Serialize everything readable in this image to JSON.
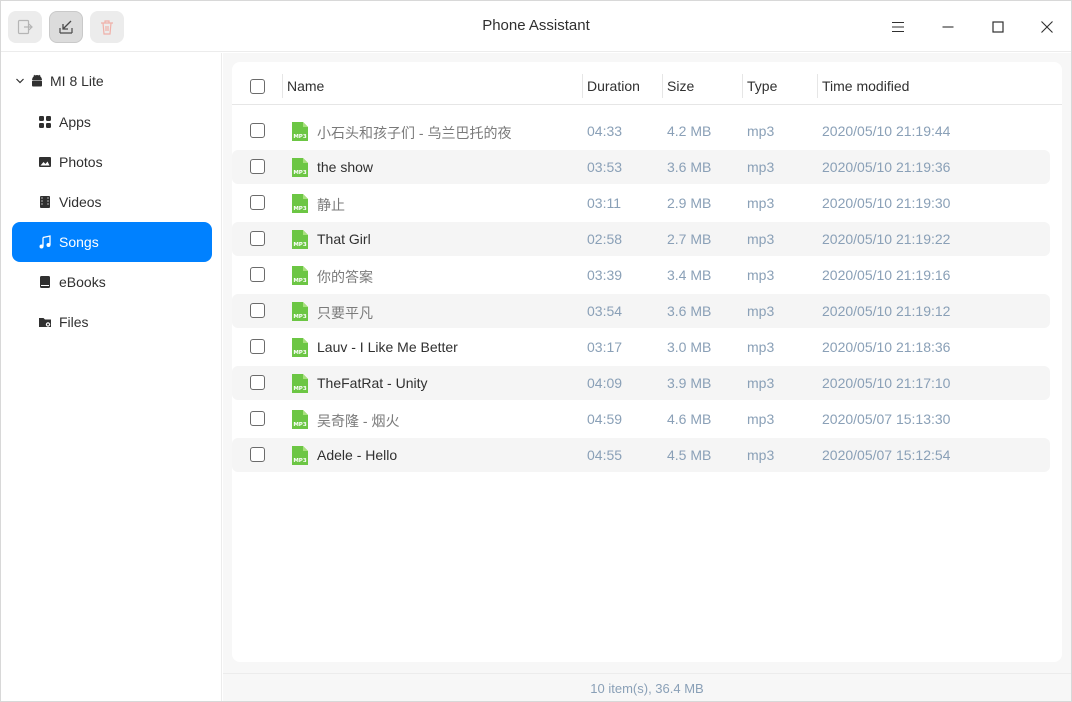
{
  "window": {
    "title": "Phone Assistant"
  },
  "toolbar": {
    "export_icon": "export-icon",
    "import_icon": "import-icon",
    "delete_icon": "trash-icon"
  },
  "sidebar": {
    "device_name": "MI 8 Lite",
    "items": [
      {
        "label": "Apps",
        "icon": "apps-icon"
      },
      {
        "label": "Photos",
        "icon": "photo-icon"
      },
      {
        "label": "Videos",
        "icon": "video-icon"
      },
      {
        "label": "Songs",
        "icon": "music-icon",
        "active": true
      },
      {
        "label": "eBooks",
        "icon": "book-icon"
      },
      {
        "label": "Files",
        "icon": "folder-icon"
      }
    ]
  },
  "table": {
    "headers": {
      "name": "Name",
      "duration": "Duration",
      "size": "Size",
      "type": "Type",
      "time": "Time modified"
    },
    "rows": [
      {
        "name": "小石头和孩子们 - 乌兰巴托的夜",
        "duration": "04:33",
        "size": "4.2 MB",
        "type": "mp3",
        "time": "2020/05/10 21:19:44"
      },
      {
        "name": "the show",
        "duration": "03:53",
        "size": "3.6 MB",
        "type": "mp3",
        "time": "2020/05/10 21:19:36"
      },
      {
        "name": "静止",
        "duration": "03:11",
        "size": "2.9 MB",
        "type": "mp3",
        "time": "2020/05/10 21:19:30"
      },
      {
        "name": "That Girl",
        "duration": "02:58",
        "size": "2.7 MB",
        "type": "mp3",
        "time": "2020/05/10 21:19:22"
      },
      {
        "name": "你的答案",
        "duration": "03:39",
        "size": "3.4 MB",
        "type": "mp3",
        "time": "2020/05/10 21:19:16"
      },
      {
        "name": "只要平凡",
        "duration": "03:54",
        "size": "3.6 MB",
        "type": "mp3",
        "time": "2020/05/10 21:19:12"
      },
      {
        "name": "Lauv - I Like Me Better",
        "duration": "03:17",
        "size": "3.0 MB",
        "type": "mp3",
        "time": "2020/05/10 21:18:36"
      },
      {
        "name": "TheFatRat - Unity",
        "duration": "04:09",
        "size": "3.9 MB",
        "type": "mp3",
        "time": "2020/05/10 21:17:10"
      },
      {
        "name": "吴奇隆 - 烟火",
        "duration": "04:59",
        "size": "4.6 MB",
        "type": "mp3",
        "time": "2020/05/07 15:13:30"
      },
      {
        "name": "Adele - Hello",
        "duration": "04:55",
        "size": "4.5 MB",
        "type": "mp3",
        "time": "2020/05/07 15:12:54"
      }
    ],
    "file_icon_label": "MP3"
  },
  "status": {
    "summary": "10 item(s), 36.4 MB"
  },
  "colors": {
    "accent": "#0081ff",
    "file_icon": "#6cc644"
  }
}
